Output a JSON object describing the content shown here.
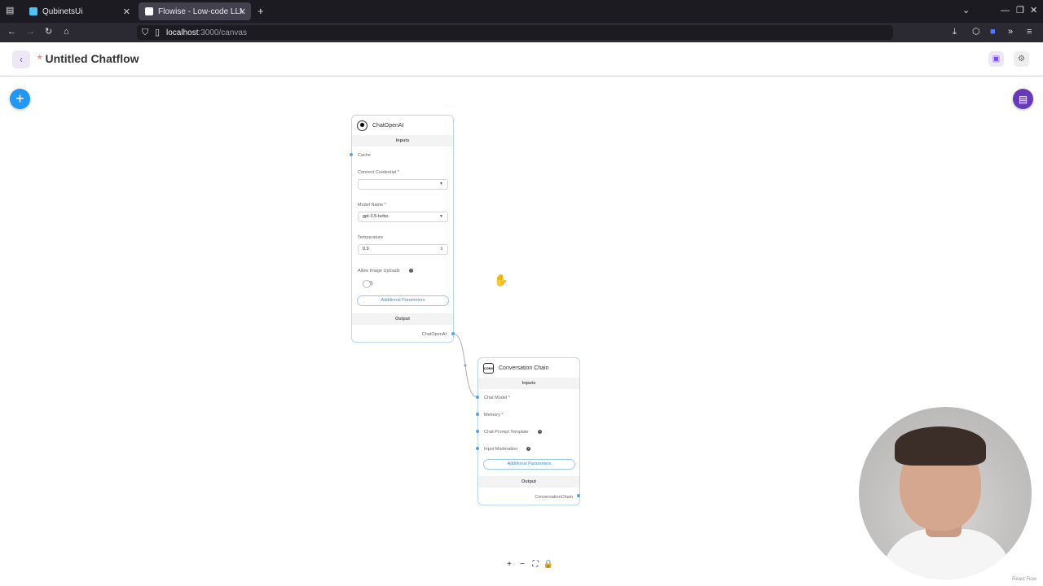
{
  "browser": {
    "tabs": [
      {
        "label": "QubinetsUi",
        "active": false
      },
      {
        "label": "Flowise - Low-code LLM ap",
        "active": true
      }
    ],
    "url_host": "localhost",
    "url_path": ":3000/canvas"
  },
  "header": {
    "unsaved_mark": "*",
    "title": "Untitled Chatflow"
  },
  "nodes": {
    "chatopenai": {
      "title": "ChatOpenAI",
      "inputs_label": "Inputs",
      "cache_label": "Cache",
      "credential_label": "Connect Credential *",
      "credential_value": "",
      "model_label": "Model Name *",
      "model_value": "gpt-3.5-turbo",
      "temperature_label": "Temperature",
      "temperature_value": "0.9",
      "image_uploads_label": "Allow Image Uploads",
      "additional_params": "Additional Parameters",
      "output_label": "Output",
      "output_value": "ChatOpenAI"
    },
    "conversation_chain": {
      "title": "Conversation Chain",
      "icon_text": "CONV",
      "inputs_label": "Inputs",
      "chat_model_label": "Chat Model *",
      "memory_label": "Memory *",
      "prompt_template_label": "Chat Prompt Template",
      "input_moderation_label": "Input Moderation",
      "additional_params": "Additional Parameters",
      "output_label": "Output",
      "output_value": "ConversationChain"
    }
  },
  "attribution": "React Flow",
  "colors": {
    "accent_blue": "#2196f3",
    "accent_purple": "#673ab7",
    "node_border": "#b9d8f0"
  }
}
